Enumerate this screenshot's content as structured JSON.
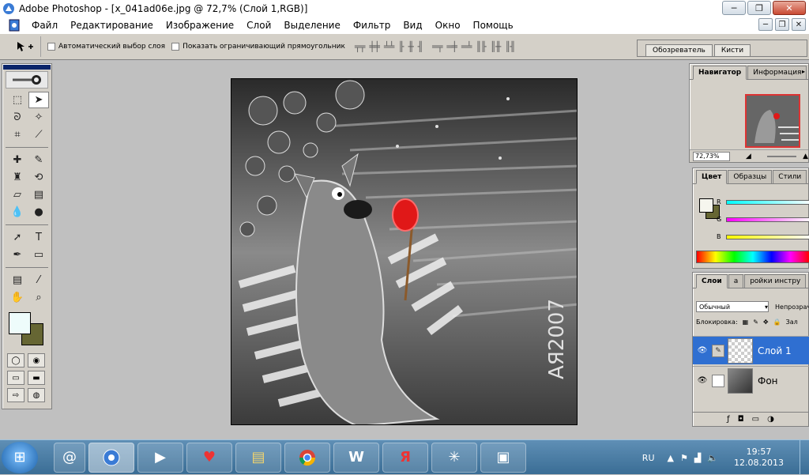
{
  "window": {
    "title": "Adobe Photoshop - [x_041ad06e.jpg @ 72,7% (Слой 1,RGB)]"
  },
  "menu": [
    "Файл",
    "Редактирование",
    "Изображение",
    "Слой",
    "Выделение",
    "Фильтр",
    "Вид",
    "Окно",
    "Помощь"
  ],
  "options": {
    "auto_select": "Автоматический выбор слоя",
    "show_bbox": "Показать ограничивающий прямоугольник",
    "well_tabs": [
      "Обозреватель",
      "Кисти"
    ]
  },
  "navigator": {
    "tabs": [
      "Навигатор",
      "Информация"
    ],
    "zoom": "72,73%"
  },
  "color": {
    "tabs": [
      "Цвет",
      "Образцы",
      "Стили"
    ],
    "channels": [
      "R",
      "G",
      "B"
    ],
    "colors": {
      "fg": "#f6f6ee",
      "bg": "#666633"
    }
  },
  "layers": {
    "tabs": [
      "Слои",
      "а",
      "ройки инстру"
    ],
    "blend_mode": "Обычный",
    "opacity_label": "Непрозрачн",
    "lock_label": "Блокировка:",
    "fill_label": "Зал",
    "items": [
      {
        "name": "Слой 1",
        "active": true
      },
      {
        "name": "Фон",
        "active": false
      }
    ]
  },
  "toolbox": {
    "fg_color": "#eefcfb",
    "bg_color": "#666633"
  },
  "taskbar": {
    "lang": "RU",
    "time": "19:57",
    "date": "12.08.2013"
  },
  "canvas": {
    "signature": "АЯ2007",
    "layer_colors": {
      "balloon": "#e01818",
      "background": "#444444"
    }
  }
}
